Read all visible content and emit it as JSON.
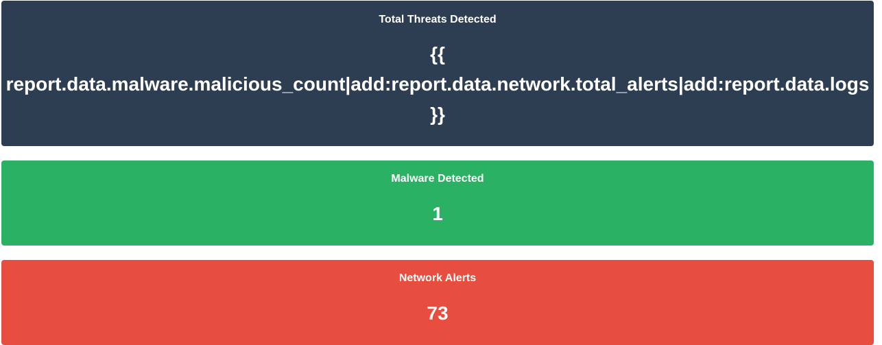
{
  "cards": {
    "total_threats": {
      "title": "Total Threats Detected",
      "value_open": "{{",
      "value_expression": "report.data.malware.malicious_count|add:report.data.network.total_alerts|add:report.data.logs",
      "value_close": "}}",
      "color": "#2e3e52"
    },
    "malware": {
      "title": "Malware Detected",
      "value": "1",
      "color": "#2ab163"
    },
    "network": {
      "title": "Network Alerts",
      "value": "73",
      "color": "#e84e3f"
    }
  }
}
